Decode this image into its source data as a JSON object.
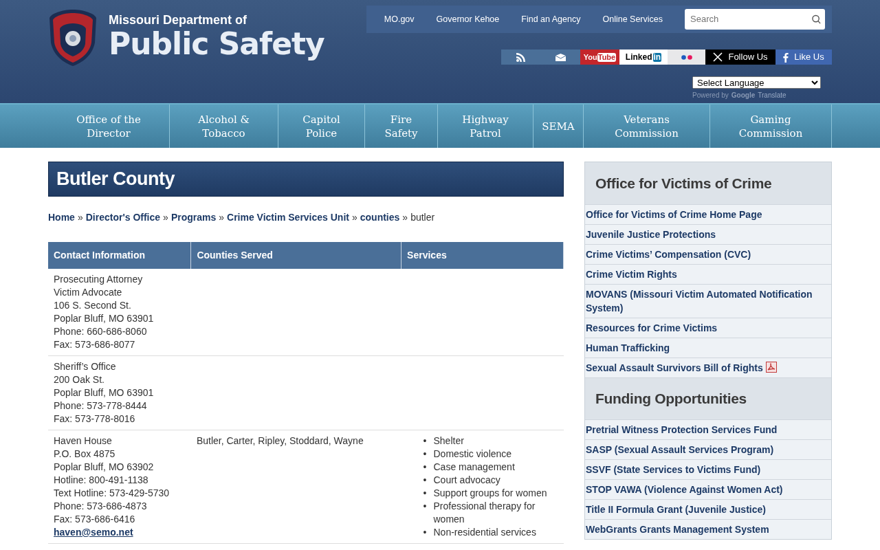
{
  "header": {
    "title_small": "Missouri Department of",
    "title_large": "Public Safety"
  },
  "top_links": [
    "MO.gov",
    "Governor Kehoe",
    "Find an Agency",
    "Online Services"
  ],
  "search": {
    "placeholder": "Search"
  },
  "social": [
    {
      "kind": "rss"
    },
    {
      "kind": "email"
    },
    {
      "kind": "youtube",
      "label": "You",
      "badge": "Tube"
    },
    {
      "kind": "linkedin",
      "label": "Linked",
      "badge": "in"
    },
    {
      "kind": "flickr"
    },
    {
      "kind": "x",
      "label": "Follow Us"
    },
    {
      "kind": "facebook",
      "label": "Like Us"
    }
  ],
  "language": {
    "value": "Select Language",
    "powered": "Powered by",
    "brand": "Google",
    "product": "Translate"
  },
  "nav": [
    {
      "lines": [
        "Office of the",
        "Director"
      ]
    },
    {
      "lines": [
        "Alcohol &",
        "Tobacco"
      ]
    },
    {
      "lines": [
        "Capitol",
        "Police"
      ]
    },
    {
      "lines": [
        "Fire",
        "Safety"
      ]
    },
    {
      "lines": [
        "Highway",
        "Patrol"
      ]
    },
    {
      "lines": [
        "SEMA"
      ]
    },
    {
      "lines": [
        "Veterans",
        "Commission"
      ]
    },
    {
      "lines": [
        "Gaming",
        "Commission"
      ]
    }
  ],
  "page_title": "Butler County",
  "breadcrumb": {
    "links": [
      "Home",
      "Director's Office",
      "Programs",
      "Crime Victim Services Unit",
      "counties"
    ],
    "separator": "»",
    "current": "butler"
  },
  "table": {
    "columns": [
      "Contact Information",
      "Counties Served",
      "Services"
    ],
    "rows": [
      {
        "contact": [
          "Prosecuting Attorney",
          "Victim Advocate",
          "106 S. Second St.",
          "Poplar Bluff, MO 63901",
          "Phone: 660-686-8060",
          "Fax: 573-686-8077"
        ]
      },
      {
        "contact": [
          "Sheriff’s Office",
          "200 Oak St.",
          "Poplar Bluff, MO 63901",
          "Phone: 573-778-8444",
          "Fax: 573-778-8016"
        ]
      },
      {
        "contact": [
          "Haven House",
          "P.O. Box 4875",
          "Poplar Bluff, MO 63902",
          "Hotline: 800-491-1138",
          "Text Hotline: 573-429-5730",
          "Phone: 573-686-4873",
          "Fax: 573-686-6416"
        ],
        "email": "haven@semo.net",
        "counties": "Butler, Carter, Ripley, Stoddard, Wayne",
        "bullet": "•",
        "services": [
          "Shelter",
          "Domestic violence",
          "Case management",
          "Court advocacy",
          "Support groups for women",
          "Professional therapy for women",
          "Non-residential services"
        ]
      }
    ]
  },
  "sidebar": [
    {
      "title": "Office for Victims of Crime",
      "links": [
        {
          "label": "Office for Victims of Crime Home Page",
          "pdf": false
        },
        {
          "label": "Juvenile Justice Protections",
          "pdf": false
        },
        {
          "label": "Crime Victims’ Compensation (CVC)",
          "pdf": false
        },
        {
          "label": "Crime Victim Rights",
          "pdf": false
        },
        {
          "label": "MOVANS (Missouri Victim Automated Notification System)",
          "pdf": false
        },
        {
          "label": "Resources for Crime Victims",
          "pdf": false
        },
        {
          "label": "Human Trafficking",
          "pdf": false
        },
        {
          "label": "Sexual Assault Survivors Bill of Rights",
          "pdf": true
        }
      ]
    },
    {
      "title": "Funding Opportunities",
      "links": [
        {
          "label": "Pretrial Witness Protection Services Fund",
          "pdf": false
        },
        {
          "label": "SASP (Sexual Assault Services Program)",
          "pdf": false
        },
        {
          "label": "SSVF (State Services to Victims Fund)",
          "pdf": false
        },
        {
          "label": "STOP VAWA (Violence Against Women Act)",
          "pdf": false
        },
        {
          "label": "Title II Formula Grant (Juvenile Justice)",
          "pdf": false
        },
        {
          "label": "WebGrants Grants Management System",
          "pdf": false
        }
      ]
    }
  ]
}
